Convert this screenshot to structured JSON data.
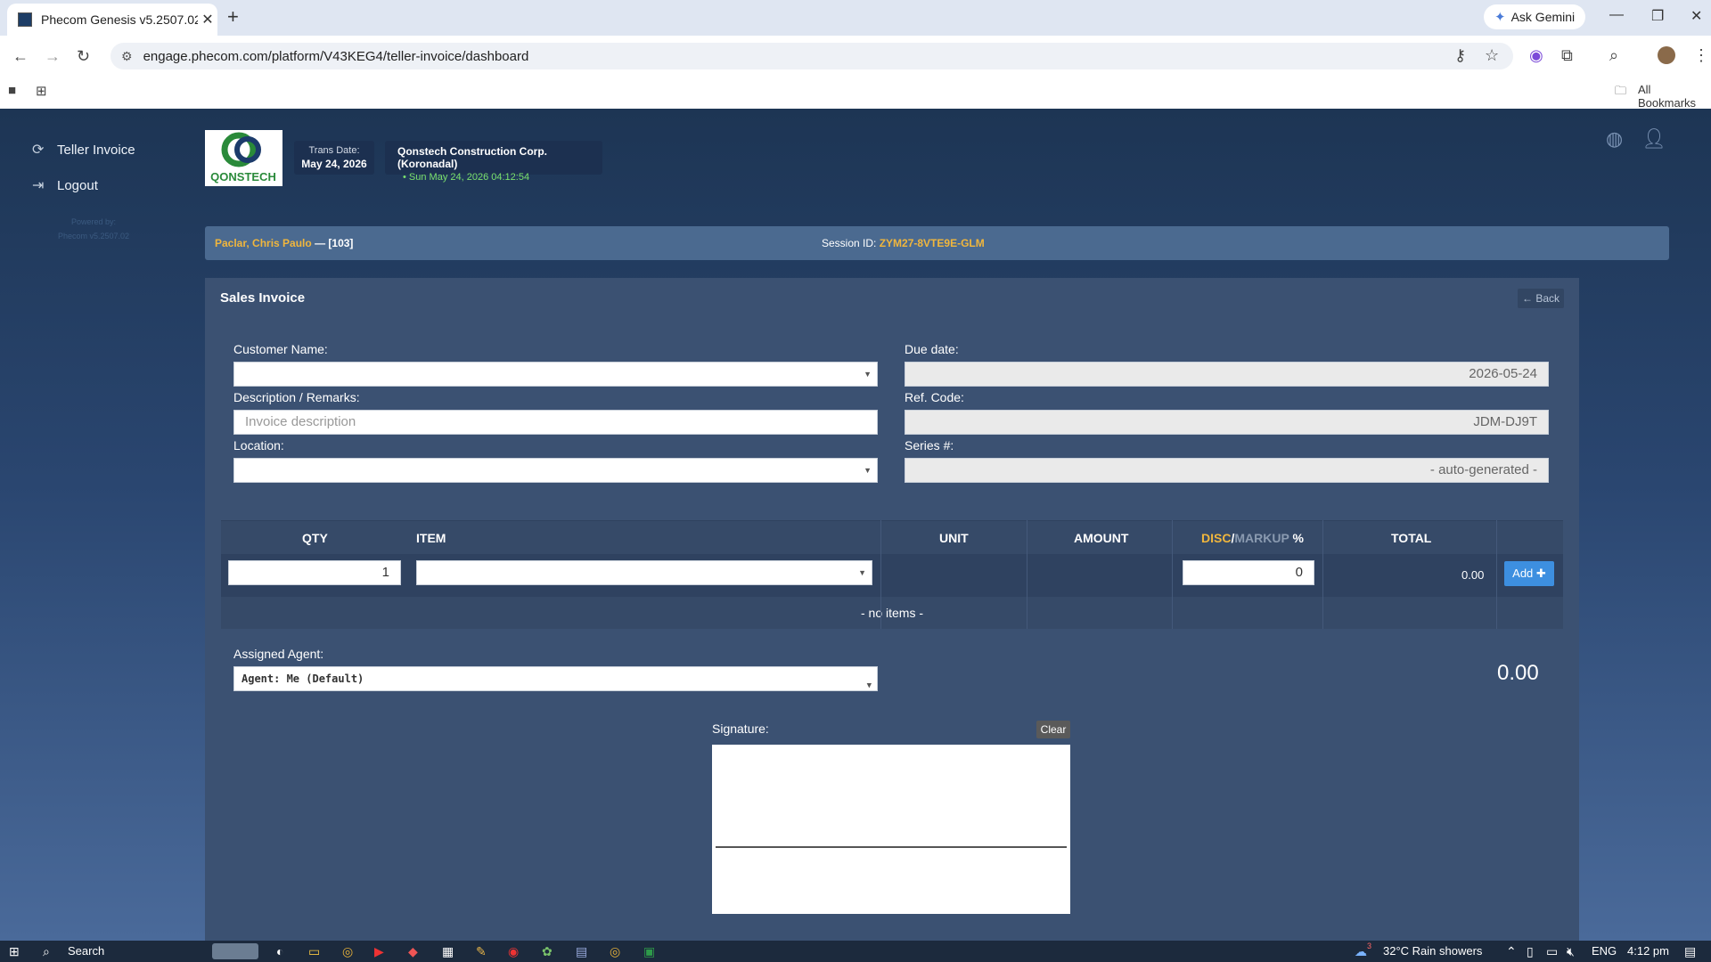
{
  "browser": {
    "tab_title": "Phecom Genesis v5.2507.02",
    "url": "engage.phecom.com/platform/V43KEG4/teller-invoice/dashboard",
    "ask_gemini": "Ask Gemini",
    "all_bookmarks": "All Bookmarks"
  },
  "sidebar": {
    "items": [
      {
        "label": "Teller Invoice",
        "icon": "refresh-icon"
      },
      {
        "label": "Logout",
        "icon": "logout-icon"
      }
    ],
    "powered_by": "Powered by:",
    "version": "Phecom v5.2507.02"
  },
  "header": {
    "logo_text": "QONSTECH",
    "trans_date_label": "Trans Date:",
    "trans_date_value": "May 24, 2026",
    "company": "Qonstech Construction Corp. (Koronadal)",
    "datetime": "Sun May 24, 2026 04:12:54"
  },
  "session": {
    "user": "Paclar, Chris Paulo",
    "user_id": "— [103]",
    "session_label": "Session ID:",
    "session_id": "ZYM27-8VTE9E-GLM"
  },
  "form": {
    "title": "Sales Invoice",
    "back_label": "Back",
    "customer_label": "Customer Name:",
    "description_label": "Description / Remarks:",
    "description_placeholder": "Invoice description",
    "location_label": "Location:",
    "due_date_label": "Due date:",
    "due_date_value": "2026-05-24",
    "ref_code_label": "Ref. Code:",
    "ref_code_value": "JDM-DJ9T",
    "series_label": "Series #:",
    "series_value": "- auto-generated -"
  },
  "table": {
    "headers": {
      "qty": "QTY",
      "item": "ITEM",
      "unit": "UNIT",
      "amount": "AMOUNT",
      "disc": "DISC",
      "slash": "/",
      "markup": "MARKUP",
      "pct": "%",
      "total": "TOTAL"
    },
    "qty_value": "1",
    "disc_value": "0",
    "row_total": "0.00",
    "add_label": "Add",
    "empty_text": "- no items -"
  },
  "agent": {
    "label": "Assigned Agent:",
    "value": "Agent: Me (Default)"
  },
  "grand_total": "0.00",
  "signature": {
    "label": "Signature:",
    "clear_label": "Clear"
  },
  "taskbar": {
    "search": "Search",
    "weather": "32°C  Rain showers",
    "lang": "ENG",
    "time": "4:12 pm",
    "weather_badge": "3"
  },
  "colors": {
    "accent_yellow": "#f0b63d",
    "add_button": "#3d8fe0",
    "live_green": "#7be06c"
  }
}
